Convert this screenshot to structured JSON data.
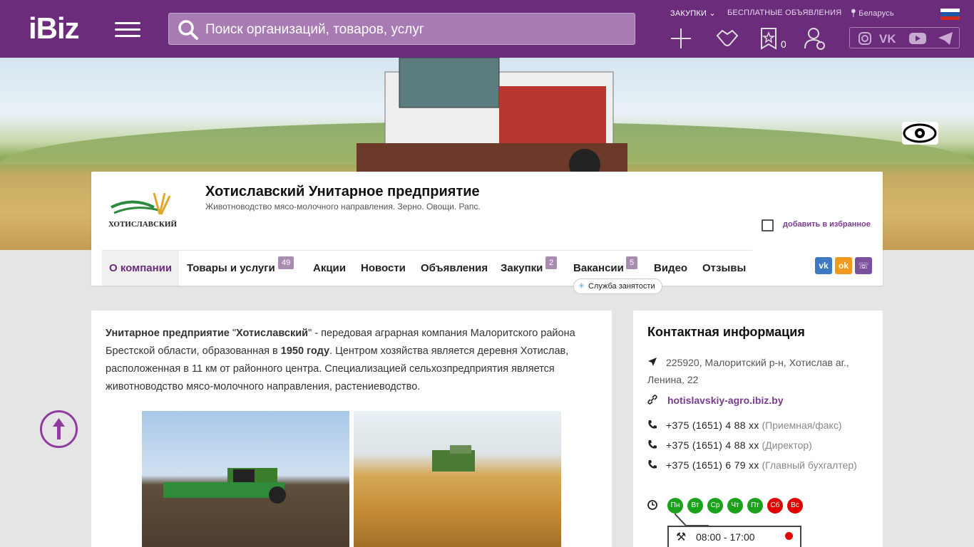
{
  "header": {
    "logo": "iBiz",
    "search_placeholder": "Поиск организаций, товаров, услуг",
    "links": {
      "purchases": "ЗАКУПКИ",
      "free_ads": "БЕСПЛАТНЫЕ ОБЪЯВЛЕНИЯ",
      "region": "Беларусь"
    },
    "favorites_count": "0",
    "colors": {
      "brand": "#6b2c7c",
      "accent": "#7a3b8e"
    }
  },
  "company": {
    "logo_text": "ХОТИСЛАВСКИЙ",
    "title": "Хотиславский Унитарное предприятие",
    "subtitle": "Животноводство мясо-молочного направления. Зерно. Овощи. Рапс.",
    "favorite_label": "добавить в избранное"
  },
  "tabs": [
    {
      "label": "О компании",
      "count": ""
    },
    {
      "label": "Товары и услуги",
      "count": "49"
    },
    {
      "label": "Акции",
      "count": ""
    },
    {
      "label": "Новости",
      "count": ""
    },
    {
      "label": "Объявления",
      "count": ""
    },
    {
      "label": "Закупки",
      "count": "2"
    },
    {
      "label": "Вакансии",
      "count": "5"
    },
    {
      "label": "Видео",
      "count": ""
    },
    {
      "label": "Отзывы",
      "count": ""
    }
  ],
  "employment_badge": "Служба занятости",
  "about": {
    "p_bold1": "Унитарное предприятие",
    "p_q1": " \"",
    "p_bold2": "Хотиславский",
    "p_t1": "\" -  передовая аграрная компания Малоритского района Брестской области, образованная в ",
    "p_bold3": "1950 году",
    "p_t2": ". Центром хозяйства является деревня Хотислав, расположенная в 11 км от районного центра. Специализацией сельхозпредприятия является животноводство мясо-молочного направления, растениеводство."
  },
  "contacts": {
    "title": "Контактная информация",
    "address": "225920, Малоритский р-н, Хотислав аг., Ленина, 22",
    "site": "hotislavskiy-agro.ibiz.by",
    "phones": [
      {
        "number": "+375 (1651) 4 88 xx",
        "note": "(Приемная/факс)"
      },
      {
        "number": "+375 (1651) 4 88 xx",
        "note": "(Директор)"
      },
      {
        "number": "+375 (1651) 6 79 xx",
        "note": "(Главный бухгалтер)"
      }
    ],
    "days": [
      "Пн",
      "Вт",
      "Ср",
      "Чт",
      "Пт",
      "Сб",
      "Вс"
    ],
    "hours": "08:00 - 17:00"
  }
}
